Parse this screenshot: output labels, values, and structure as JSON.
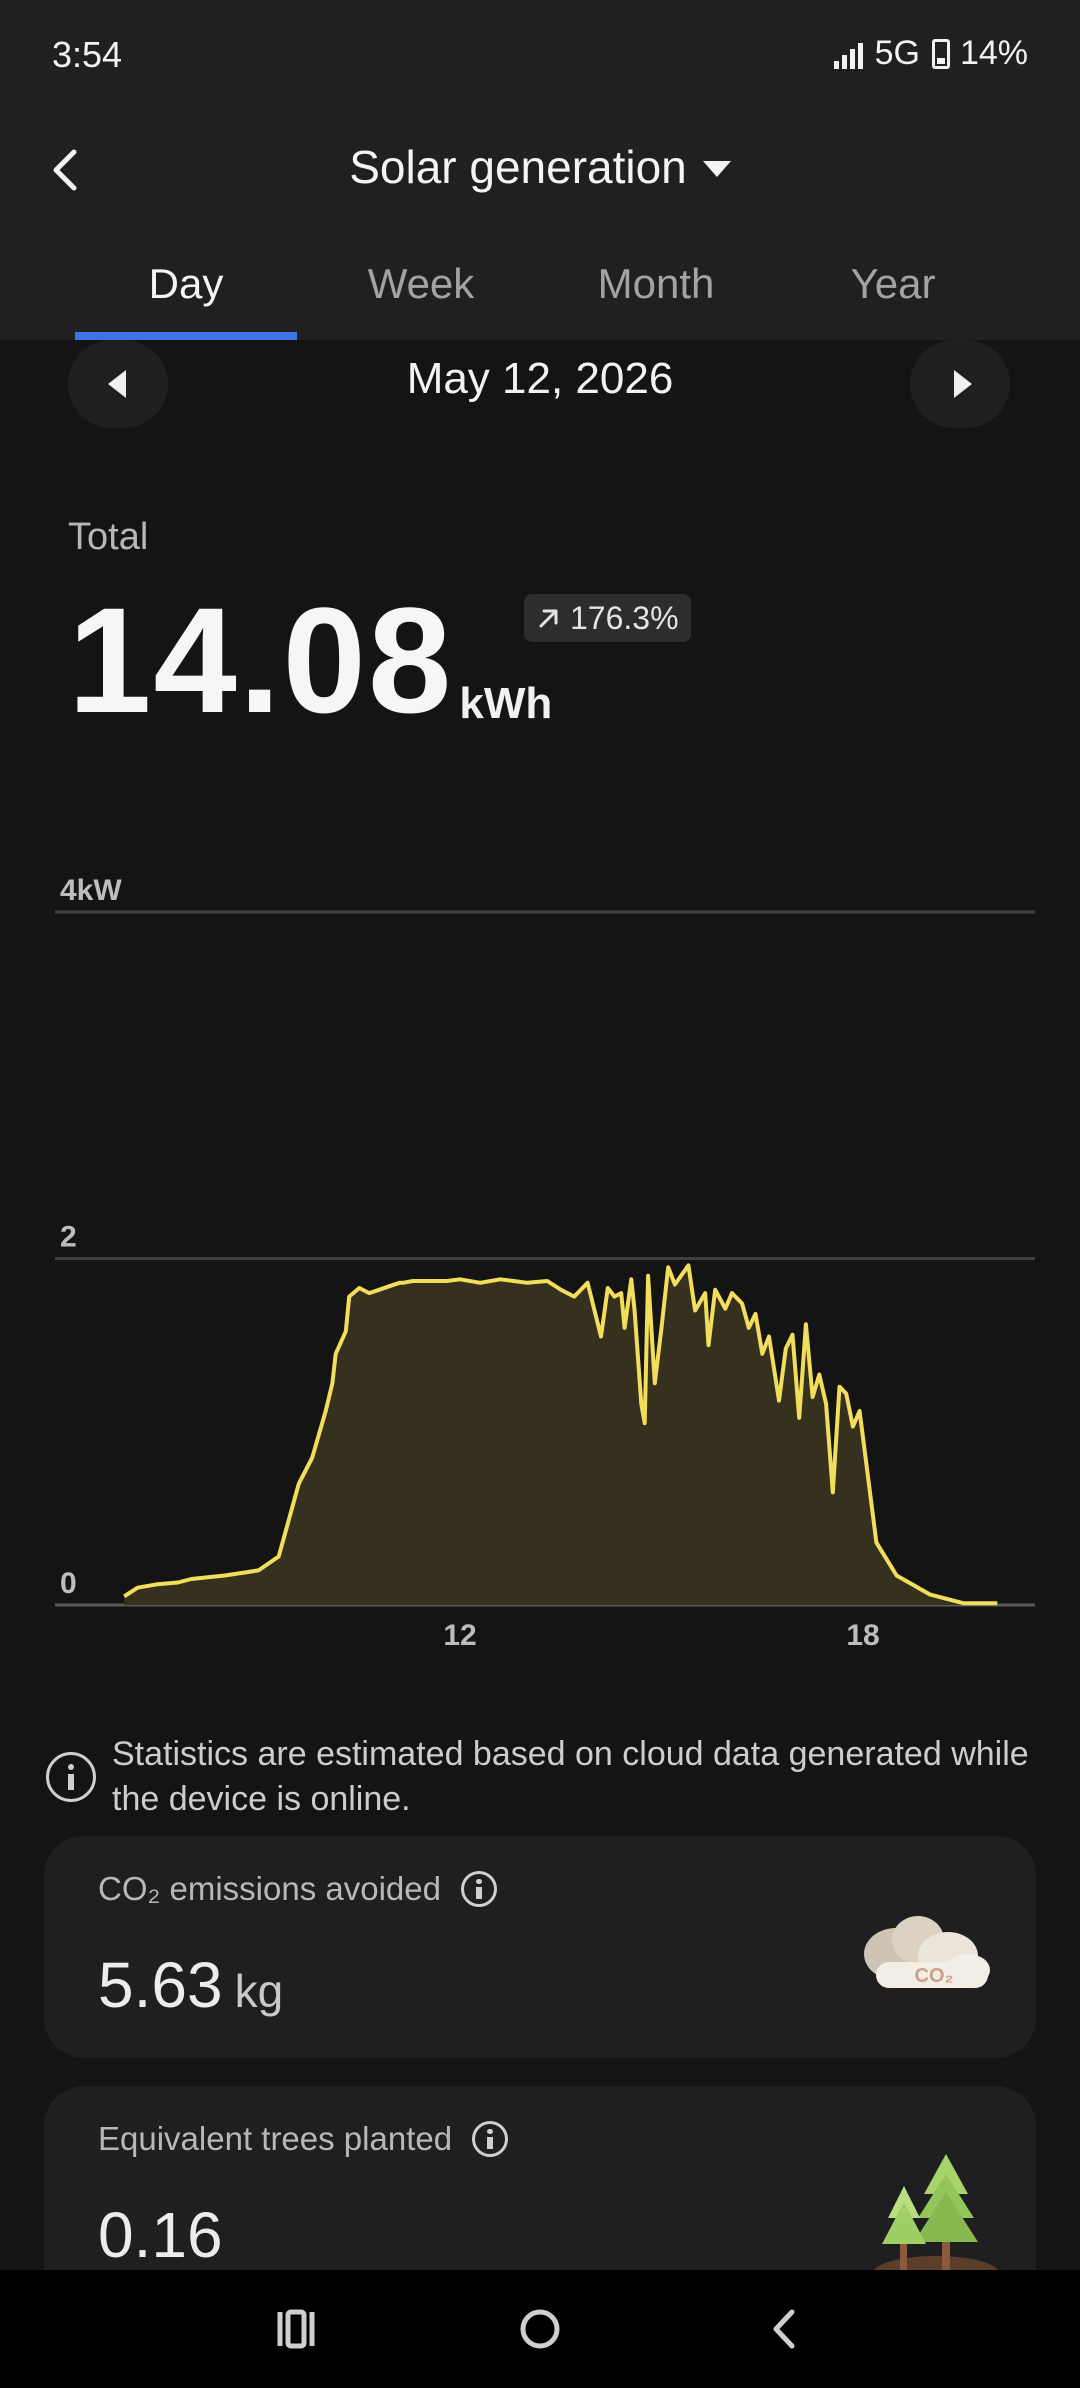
{
  "status_bar": {
    "time": "3:54",
    "network": "5G",
    "battery": "14%"
  },
  "header": {
    "title": "Solar generation",
    "back_icon": "chevron-left-icon",
    "dropdown_icon": "caret-down-icon"
  },
  "tabs": [
    {
      "label": "Day",
      "active": true
    },
    {
      "label": "Week",
      "active": false
    },
    {
      "label": "Month",
      "active": false
    },
    {
      "label": "Year",
      "active": false
    }
  ],
  "date_nav": {
    "date": "May 12, 2026",
    "prev_icon": "triangle-left-icon",
    "next_icon": "triangle-right-icon"
  },
  "total": {
    "label": "Total",
    "value": "14.08",
    "unit": "kWh",
    "change": "176.3%",
    "change_icon": "arrow-up-right-icon"
  },
  "chart_data": {
    "type": "area",
    "title": "",
    "xlabel": "",
    "ylabel": "",
    "y_unit": "kW",
    "y_ticks": [
      "0",
      "2",
      "4kW"
    ],
    "ylim": [
      0,
      4
    ],
    "x_ticks": [
      "12",
      "18"
    ],
    "x_tick_values": [
      12,
      18
    ],
    "xlim": [
      6,
      20.5
    ],
    "grid": true,
    "legend": "none",
    "line_color": "#F2DE5A",
    "fill_color": "#36301F",
    "series": [
      {
        "x": [
          7.0,
          7.2,
          7.5,
          7.8,
          8.0,
          8.5,
          9.0,
          9.3,
          9.6,
          9.8,
          10.0,
          10.1,
          10.15,
          10.3,
          10.35,
          10.5,
          10.65,
          10.8,
          10.95,
          11.1,
          11.15,
          11.3,
          11.5,
          11.8,
          12.0,
          12.3,
          12.6,
          12.8,
          13.0,
          13.3,
          13.5,
          13.7,
          13.9,
          14.1,
          14.2,
          14.3,
          14.4,
          14.45,
          14.55,
          14.6,
          14.7,
          14.75,
          14.8,
          14.9,
          15.0,
          15.1,
          15.2,
          15.4,
          15.5,
          15.65,
          15.7,
          15.8,
          15.95,
          16.05,
          16.2,
          16.3,
          16.4,
          16.5,
          16.6,
          16.75,
          16.85,
          16.95,
          17.05,
          17.15,
          17.25,
          17.35,
          17.45,
          17.55,
          17.65,
          17.75,
          17.85,
          17.95,
          18.2,
          18.5,
          19.0,
          19.3,
          19.5,
          19.8,
          20.0
        ],
        "values": [
          0.05,
          0.1,
          0.12,
          0.13,
          0.15,
          0.17,
          0.2,
          0.28,
          0.7,
          0.85,
          1.12,
          1.28,
          1.45,
          1.58,
          1.78,
          1.83,
          1.8,
          1.82,
          1.84,
          1.86,
          1.86,
          1.87,
          1.87,
          1.87,
          1.88,
          1.86,
          1.88,
          1.87,
          1.86,
          1.87,
          1.82,
          1.78,
          1.86,
          1.55,
          1.83,
          1.78,
          1.8,
          1.6,
          1.88,
          1.7,
          1.16,
          1.05,
          1.9,
          1.28,
          1.6,
          1.95,
          1.85,
          1.96,
          1.7,
          1.8,
          1.5,
          1.82,
          1.71,
          1.8,
          1.74,
          1.6,
          1.68,
          1.45,
          1.55,
          1.18,
          1.48,
          1.56,
          1.08,
          1.62,
          1.2,
          1.33,
          1.16,
          0.65,
          1.26,
          1.22,
          1.03,
          1.12,
          0.36,
          0.17,
          0.06,
          0.03,
          0.01,
          0.01,
          0.01
        ]
      }
    ]
  },
  "info_note": {
    "icon": "info-icon",
    "text": "Statistics are estimated based on cloud data generated while the device is online."
  },
  "cards": [
    {
      "label": "CO₂ emissions avoided",
      "value": "5.63",
      "unit": "kg",
      "illustration": "co2-cloud-icon",
      "illustration_text": "CO₂"
    },
    {
      "label": "Equivalent trees planted",
      "value": "0.16",
      "unit": "",
      "illustration": "trees-icon"
    }
  ],
  "nav_bar": {
    "recents_icon": "recents-icon",
    "home_icon": "home-icon",
    "back_icon": "back-icon"
  }
}
